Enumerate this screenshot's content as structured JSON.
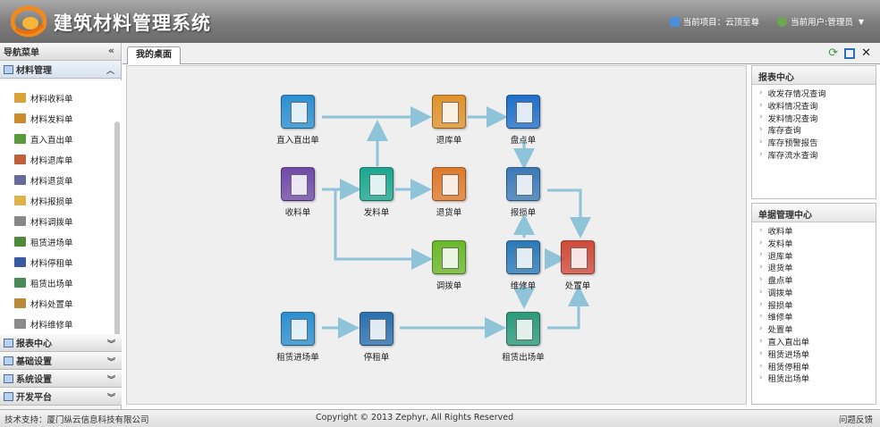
{
  "header": {
    "title": "建筑材料管理系统",
    "project_label": "当前项目：云顶至尊",
    "user_label": "当前用户:管理员"
  },
  "sidebar": {
    "title": "导航菜单",
    "active_section": "材料管理",
    "menu_items": [
      {
        "label": "材料收料单",
        "icon": "receipt-icon",
        "color": "#d9a33a"
      },
      {
        "label": "材料发料单",
        "icon": "issue-icon",
        "color": "#c98b2d"
      },
      {
        "label": "直入直出单",
        "icon": "transfer-icon",
        "color": "#5a9a3a"
      },
      {
        "label": "材料退库单",
        "icon": "return-icon",
        "color": "#c0603a"
      },
      {
        "label": "材料退货单",
        "icon": "return-goods-icon",
        "color": "#6a6a9a"
      },
      {
        "label": "材料报损单",
        "icon": "damage-icon",
        "color": "#e0b24a"
      },
      {
        "label": "材料调拨单",
        "icon": "allocate-icon",
        "color": "#888888"
      },
      {
        "label": "租赁进场单",
        "icon": "lease-in-icon",
        "color": "#4f8a3a"
      },
      {
        "label": "材料停租单",
        "icon": "stop-lease-icon",
        "color": "#3a5aa0"
      },
      {
        "label": "租赁出场单",
        "icon": "lease-out-icon",
        "color": "#4a8a5a"
      },
      {
        "label": "材料处置单",
        "icon": "dispose-icon",
        "color": "#b88a3a"
      },
      {
        "label": "材料维修单",
        "icon": "repair-icon",
        "color": "#8a8a8a"
      }
    ],
    "collapsed_sections": [
      "报表中心",
      "基础设置",
      "系统设置",
      "开发平台"
    ]
  },
  "tabs": {
    "active": "我的桌面"
  },
  "desktop": {
    "nodes": [
      {
        "id": "zrzc",
        "label": "直入直出单",
        "color": "#2a8fd0"
      },
      {
        "id": "tkd",
        "label": "退库单",
        "color": "#e0922a"
      },
      {
        "id": "pdd",
        "label": "盘点单",
        "color": "#1f6fc8"
      },
      {
        "id": "sld",
        "label": "收料单",
        "color": "#6f4aa8"
      },
      {
        "id": "fld",
        "label": "发料单",
        "color": "#1aa890"
      },
      {
        "id": "thd",
        "label": "退货单",
        "color": "#e07a2a"
      },
      {
        "id": "bsd",
        "label": "报损单",
        "color": "#3a7ab8"
      },
      {
        "id": "dbd",
        "label": "调拨单",
        "color": "#6ab82a"
      },
      {
        "id": "wxd",
        "label": "维修单",
        "color": "#2a7ab8"
      },
      {
        "id": "czd",
        "label": "处置单",
        "color": "#d04a3a"
      },
      {
        "id": "zljc",
        "label": "租赁进场单",
        "color": "#2a8fd0"
      },
      {
        "id": "tzd",
        "label": "停租单",
        "color": "#2a6fb0"
      },
      {
        "id": "zlcc",
        "label": "租赁出场单",
        "color": "#2a9a7a"
      }
    ]
  },
  "report_center": {
    "title": "报表中心",
    "items": [
      "收发存情况查询",
      "收料情况查询",
      "发料情况查询",
      "库存查询",
      "库存预警报告",
      "库存流水查询"
    ]
  },
  "doc_center": {
    "title": "单据管理中心",
    "items": [
      "收料单",
      "发料单",
      "退库单",
      "退货单",
      "盘点单",
      "调拨单",
      "报损单",
      "维修单",
      "处置单",
      "直入直出单",
      "租赁进场单",
      "租赁停租单",
      "租赁出场单"
    ]
  },
  "footer": {
    "support": "技术支持：厦门纵云信息科技有限公司",
    "copyright": "Copyright © 2013 Zephyr, All Rights Reserved",
    "feedback": "问题反馈"
  }
}
